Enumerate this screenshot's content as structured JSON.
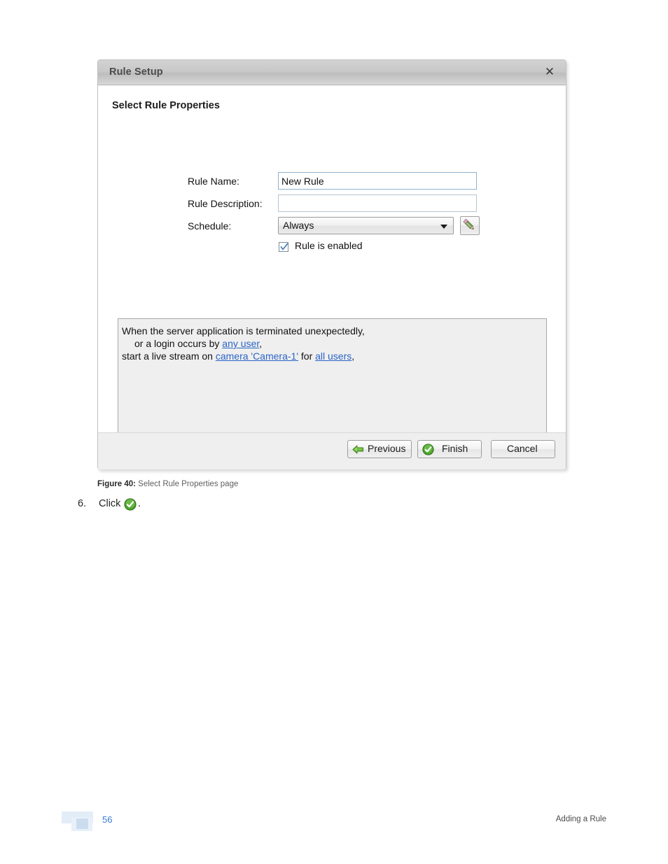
{
  "dialog": {
    "title": "Rule Setup",
    "close_icon": "close-icon",
    "heading": "Select Rule Properties",
    "form": {
      "rule_name": {
        "label": "Rule Name:",
        "value": "New Rule",
        "placeholder": ""
      },
      "rule_description": {
        "label": "Rule Description:",
        "value": "",
        "placeholder": ""
      },
      "schedule": {
        "label": "Schedule:",
        "selected": "Always",
        "options": [
          "Always"
        ],
        "edit_icon": "pencil-icon"
      },
      "rule_enabled": {
        "label": "Rule is enabled",
        "checked": true
      }
    },
    "summary": {
      "line1_text": "When the server application is terminated unexpectedly,",
      "line2_prefix": "or a login occurs by ",
      "line2_link": "any user",
      "line2_suffix": ",",
      "line3_prefix": "start a live stream on ",
      "line3_link1": "camera 'Camera-1'",
      "line3_mid": " for ",
      "line3_link2": "all users",
      "line3_suffix": ","
    },
    "buttons": {
      "previous": {
        "label": "Previous",
        "icon": "green-left-arrow-icon"
      },
      "finish": {
        "label": "Finish",
        "icon": "green-check-icon"
      },
      "cancel": {
        "label": "Cancel"
      }
    }
  },
  "page": {
    "figure_label": "Figure 40:",
    "figure_caption": " Select Rule Properties page",
    "step_number": "6.",
    "step_text": "Click",
    "step_icon": "green-check-icon",
    "step_period": ".",
    "page_number": "56",
    "footer_right": "Adding a Rule"
  },
  "colors": {
    "link": "#2a64c8",
    "page_number": "#3b7ddd",
    "accent_green": "#5aa832"
  }
}
